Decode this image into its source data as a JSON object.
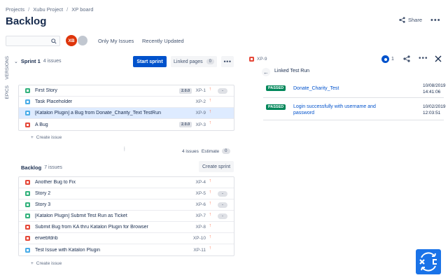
{
  "breadcrumb": [
    "Projects",
    "Xubu Project",
    "XP board"
  ],
  "page_title": "Backlog",
  "header": {
    "share_label": "Share"
  },
  "filters": {
    "avatar_initials": "XB",
    "only_my_issues": "Only My Issues",
    "recently_updated": "Recently Updated"
  },
  "side_tabs": {
    "versions": "VERSIONS",
    "epics": "EPICS"
  },
  "sprint": {
    "name": "Sprint 1",
    "count": "4 issues",
    "start_label": "Start sprint",
    "linked_pages_label": "Linked pages",
    "linked_pages_count": "0",
    "summary_count": "4 issues",
    "estimate_label": "Estimate",
    "estimate_value": "0",
    "create_issue": "Create issue",
    "issues": [
      {
        "type": "story",
        "summary": "First Story",
        "version": "2.0.0",
        "key": "XP-1",
        "estimate": "-"
      },
      {
        "type": "task",
        "summary": "Task Placeholder",
        "version": "",
        "key": "XP-2",
        "estimate": ""
      },
      {
        "type": "task",
        "summary": "[Katalon Plugin] a Bug from Donate_Charity_Text TestRun",
        "version": "",
        "key": "XP-9",
        "estimate": ""
      },
      {
        "type": "bug",
        "summary": "A Bug",
        "version": "2.0.0",
        "key": "XP-3",
        "estimate": "-"
      }
    ]
  },
  "backlog": {
    "name": "Backlog",
    "count": "7 issues",
    "create_sprint_label": "Create sprint",
    "create_issue": "Create issue",
    "issues": [
      {
        "type": "bug",
        "summary": "Another Bug to Fix",
        "key": "XP-4",
        "estimate": ""
      },
      {
        "type": "story",
        "summary": "Story 2",
        "key": "XP-5",
        "estimate": "-"
      },
      {
        "type": "story",
        "summary": "Story 3",
        "key": "XP-6",
        "estimate": "-"
      },
      {
        "type": "story",
        "summary": "[Katalon Plugin] Submit Test Run as Ticket",
        "key": "XP-7",
        "estimate": "-"
      },
      {
        "type": "bug",
        "summary": "Submit Bug from KA thru Katalon Plugin for Browser",
        "key": "XP-8",
        "estimate": ""
      },
      {
        "type": "bug",
        "summary": "erwebfdnb",
        "key": "XP-10",
        "estimate": ""
      },
      {
        "type": "task",
        "summary": "Test Issue with Katalon Plugin",
        "key": "XP-11",
        "estimate": ""
      }
    ]
  },
  "detail_panel": {
    "issue_key": "XP-9",
    "watch_count": "1",
    "title": "Linked Test Run",
    "test_runs": [
      {
        "status": "PASSED",
        "name": "Donate_Charity_Test",
        "date": "10/08/2019",
        "time": "14:41:06"
      },
      {
        "status": "PASSED",
        "name": "Login successfully with username and password",
        "date": "10/02/2019",
        "time": "12:03:51"
      }
    ]
  },
  "colors": {
    "primary": "#0052cc",
    "story": "#36b37e",
    "task": "#4bade8",
    "bug": "#e5493a",
    "passed": "#00875a",
    "priority": "#ff7452"
  }
}
